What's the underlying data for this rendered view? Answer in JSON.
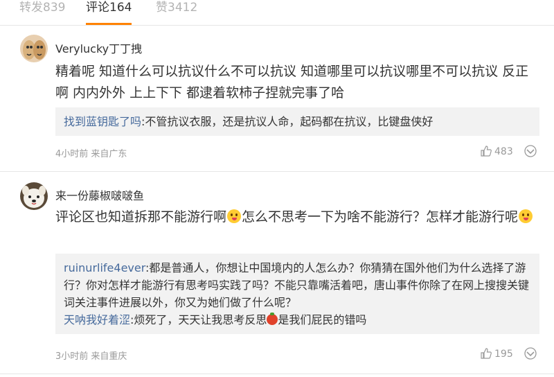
{
  "tabs": [
    {
      "label": "转发839"
    },
    {
      "label": "评论164"
    },
    {
      "label": "赞3412"
    }
  ],
  "comments": [
    {
      "username": "Verylucky丁丁拽",
      "text": "精着呢 知道什么可以抗议什么不可以抗议 知道哪里可以抗议哪里不可以抗议 反正啊 内内外外 上上下下 都逮着软柿子捏就完事了哈",
      "reply": {
        "user": "找到蓝钥匙了吗",
        "text": ":不管抗议衣服，还是抗议人命，起码都在抗议，比键盘侠好"
      },
      "meta": "4小时前 来自广东",
      "likes": "483"
    },
    {
      "username": "来一份藤椒啵啵鱼",
      "text_a": "评论区也知道拆那不能游行啊",
      "text_b": "怎么不思考一下为啥不能游行？怎样才能游行呢",
      "replies": [
        {
          "user": "ruinurlife4ever",
          "text": ":都是普通人，你想让中国境内的人怎么办？你猜猜在国外他们为什么选择了游行？你对怎样才能游行有思考吗实践了吗？不能只靠嘴活着吧，唐山事件你除了在网上搜搜关键词关注事件进展以外，你又为她们做了什么呢？"
        },
        {
          "user": "天呐我好着涩",
          "text_a": ":烦死了，天天让我思考反思",
          "text_b": "是我们屁民的错吗"
        }
      ],
      "meta": "3小时前 来自重庆",
      "likes": "195"
    }
  ]
}
